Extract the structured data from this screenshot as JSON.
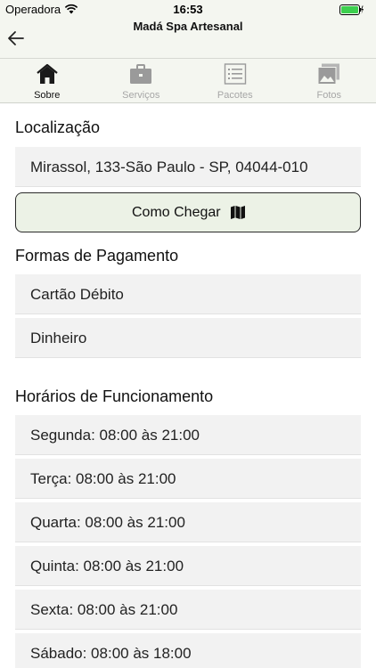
{
  "status_bar": {
    "carrier": "Operadora",
    "time": "16:53"
  },
  "header": {
    "title": "Madá Spa Artesanal"
  },
  "tabs": [
    {
      "label": "Sobre",
      "icon": "home-icon",
      "active": true
    },
    {
      "label": "Serviços",
      "icon": "briefcase-icon",
      "active": false
    },
    {
      "label": "Pacotes",
      "icon": "list-icon",
      "active": false
    },
    {
      "label": "Fotos",
      "icon": "photos-icon",
      "active": false
    }
  ],
  "location": {
    "title": "Localização",
    "address": "Mirassol, 133-São Paulo - SP, 04044-010",
    "directions_label": "Como Chegar"
  },
  "payment": {
    "title": "Formas de Pagamento",
    "methods": [
      "Cartão Débito",
      "Dinheiro"
    ]
  },
  "hours": {
    "title": "Horários de Funcionamento",
    "days": [
      "Segunda: 08:00 às 21:00",
      "Terça: 08:00 às 21:00",
      "Quarta: 08:00 às 21:00",
      "Quinta: 08:00 às 21:00",
      "Sexta: 08:00 às 21:00",
      "Sábado: 08:00 às 18:00"
    ]
  },
  "colors": {
    "bar_background": "#f4f6f0",
    "button_background": "#ecf2e6",
    "row_background": "#f2f2f2",
    "inactive_tab": "#a6a6a6"
  }
}
